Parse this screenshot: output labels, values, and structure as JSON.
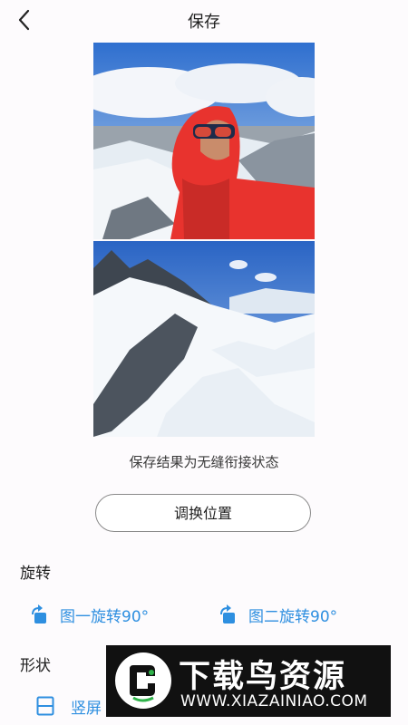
{
  "header": {
    "title": "保存"
  },
  "preview": {
    "caption": "保存结果为无缝衔接状态",
    "swap_label": "调换位置"
  },
  "rotate": {
    "label": "旋转",
    "rotate_image1_label": "图一旋转90°",
    "rotate_image2_label": "图二旋转90°"
  },
  "shape": {
    "label": "形状",
    "option_vertical_label": "竖屏"
  },
  "watermark": {
    "title": "下载鸟资源",
    "url": "WWW.XIAZAINIAO.COM"
  },
  "colors": {
    "accent": "#2e8fe0",
    "jacket": "#e8332e"
  },
  "icons": {
    "back": "chevron-left-icon",
    "rotate": "rotate-icon",
    "vertical": "vertical-split-icon"
  }
}
